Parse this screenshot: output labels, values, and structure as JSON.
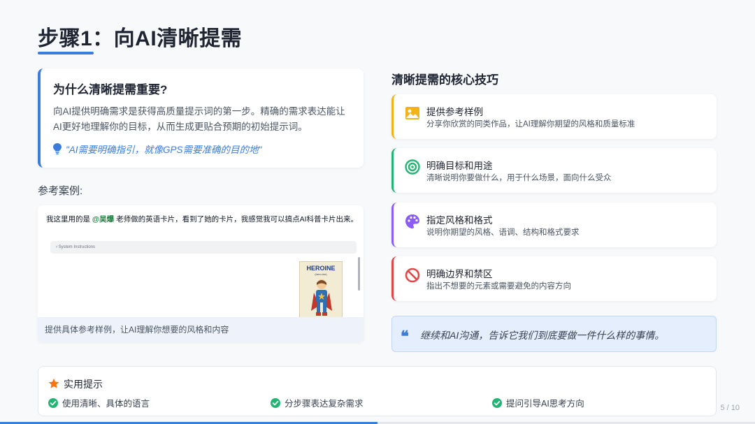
{
  "slide": {
    "title": "步骤1：向AI清晰提需",
    "page_indicator": "5 / 10",
    "progress": 0.5
  },
  "why": {
    "title": "为什么清晰提需重要?",
    "body": "向AI提供明确需求是获得高质量提示词的第一步。精确的需求表达能让AI更好地理解你的目标，从而生成更贴合预期的初始提示词。",
    "quote": "\"AI需要明确指引，就像GPS需要准确的目的地\""
  },
  "case": {
    "label": "参考案例:",
    "screenshot_text_prefix": "我这里用的是",
    "screenshot_mention": "@吴爆",
    "screenshot_text_suffix": "老师做的英语卡片，看到了她的卡片，我感觉我可以搞点AI科普卡片出来。",
    "system_instructions": "System Instructions",
    "poster_title": "HEROINE",
    "poster_subtitle": "(hero-ine)",
    "caption": "提供具体参考样例，让AI理解你想要的风格和内容"
  },
  "tips": {
    "heading": "清晰提需的核心技巧",
    "items": [
      {
        "title": "提供参考样例",
        "desc": "分享你欣赏的同类作品，让AI理解你期望的风格和质量标准",
        "icon": "image-icon",
        "color": "#f2b21c"
      },
      {
        "title": "明确目标和用途",
        "desc": "清晰说明你要做什么，用于什么场景，面向什么受众",
        "icon": "target-icon",
        "color": "#22b573"
      },
      {
        "title": "指定风格和格式",
        "desc": "说明你期望的风格、语调、结构和格式要求",
        "icon": "palette-icon",
        "color": "#8b5cf6"
      },
      {
        "title": "明确边界和禁区",
        "desc": "指出不想要的元素或需要避免的内容方向",
        "icon": "ban-icon",
        "color": "#e04848"
      }
    ]
  },
  "quote_box": {
    "text": "继续和AI沟通，告诉它我们到底要做一件什么样的事情。",
    "icon": "quote-icon"
  },
  "practical": {
    "title": "实用提示",
    "items": [
      "使用清晰、具体的语言",
      "分步骤表达复杂需求",
      "提问引导AI思考方向"
    ]
  },
  "colors": {
    "accent": "#3b7ddd",
    "check": "#22b573",
    "star": "#f97316"
  }
}
